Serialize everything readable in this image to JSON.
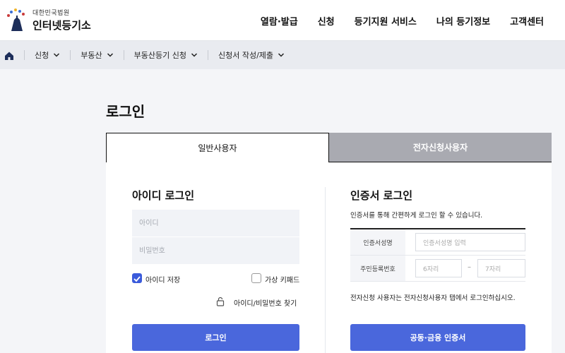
{
  "header": {
    "logo_sub": "대한민국법원",
    "logo_main": "인터넷등기소",
    "nav": [
      "열람·발급",
      "신청",
      "등기지원 서비스",
      "나의 등기정보",
      "고객센터"
    ]
  },
  "breadcrumb": [
    "신청",
    "부동산",
    "부동산등기 신청",
    "신청서 작성/제출"
  ],
  "page_title": "로그인",
  "tabs": {
    "general": "일반사용자",
    "electronic": "전자신청사용자"
  },
  "id_login": {
    "title": "아이디 로그인",
    "id_placeholder": "아이디",
    "pw_placeholder": "비밀번호",
    "save_id": "아이디 저장",
    "virtual_keypad": "가상 키패드",
    "find": "아이디/비밀번호 찾기",
    "login_button": "로그인"
  },
  "cert_login": {
    "title": "인증서 로그인",
    "desc": "인증서를 통해 간편하게 로그인 할 수 있습니다.",
    "name_label": "인증서성명",
    "name_placeholder": "인증서성명 입력",
    "rrn_label": "주민등록번호",
    "rrn1_placeholder": "6자리",
    "rrn_dash": "–",
    "rrn2_placeholder": "7자리",
    "notice": "전자신청 사용자는 전자신청사용자 탭에서 로그인하십시오.",
    "button": "공동·금융 인증서"
  },
  "colors": {
    "accent": "#4a67dc",
    "tab_inactive": "#a9aab1"
  }
}
